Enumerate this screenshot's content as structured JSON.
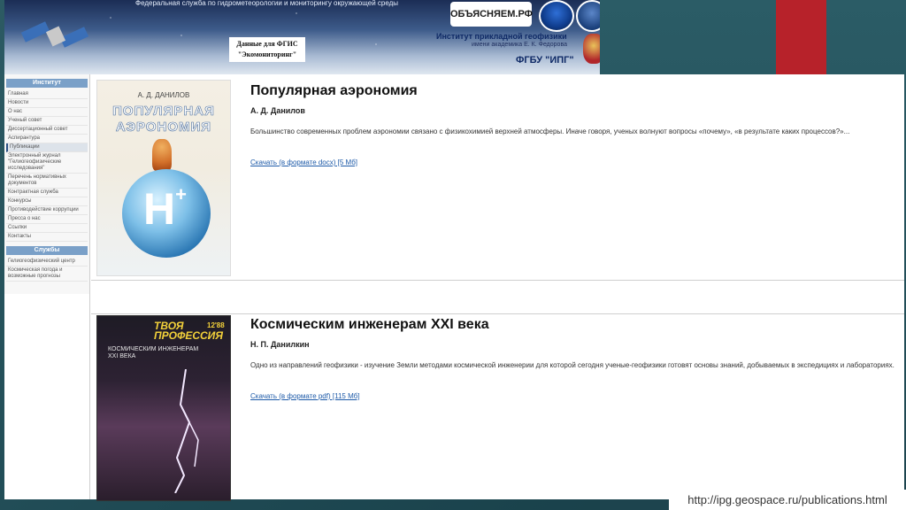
{
  "header": {
    "agency": "Федеральная служба по гидрометеорологии и мониторингу окружающей среды",
    "egis_line1": "Данные для ФГИС",
    "egis_line2": "\"Экомониторинг\"",
    "obyasnyaem": "ОБЪЯСНЯЕМ.РФ",
    "institute_title": "Институт прикладной геофизики",
    "institute_sub": "имени академика Е. К. Федорова",
    "fgbu": "ФГБУ \"ИПГ\""
  },
  "sidebar": {
    "institute_header": "Институт",
    "items": [
      {
        "label": "Главная"
      },
      {
        "label": "Новости"
      },
      {
        "label": "О нас"
      },
      {
        "label": "Ученый совет"
      },
      {
        "label": "Диссертационный совет"
      },
      {
        "label": "Аспирантура"
      },
      {
        "label": "Публикации"
      },
      {
        "label": "Электронный журнал \"Гелиогеофизические исследования\""
      },
      {
        "label": "Перечень нормативных документов"
      },
      {
        "label": "Контрактная служба"
      },
      {
        "label": "Конкурсы"
      },
      {
        "label": "Противодействие коррупции"
      },
      {
        "label": "Пресса о нас"
      },
      {
        "label": "Ссылки"
      },
      {
        "label": "Контакты"
      }
    ],
    "services_header": "Службы",
    "services": [
      {
        "label": "Гелиогеофизический центр"
      },
      {
        "label": "Космическая погода и возможные прогнозы"
      }
    ]
  },
  "publications": [
    {
      "cover_author": "А. Д. ДАНИЛОВ",
      "cover_title": "ПОПУЛЯРНАЯ АЭРОНОМИЯ",
      "title": "Популярная аэрономия",
      "author": "А. Д. Данилов",
      "description": "Большинство современных проблем аэрономии связано с физикохимией верхней атмосферы. Иначе говоря, ученых волнуют вопросы «почему», «в результате каких процессов?»...",
      "link": "Скачать (в формате docx) [5 Мб]"
    },
    {
      "cover_head": "ТВОЯ ПРОФЕССИЯ",
      "cover_num": "12'88",
      "cover_sub": "КОСМИЧЕСКИМ ИНЖЕНЕРАМ XXI ВЕКА",
      "title": "Космическим инженерам XXI века",
      "author": "Н. П. Данилкин",
      "description": "Одно из направлений геофизики - изучение Земли методами космической инженерии для которой сегодня ученые-геофизики готовят основы знаний, добываемых в экспедициях и лабораториях.",
      "link": "Скачать (в формате pdf) [115 Мб]"
    }
  ],
  "url": "http://ipg.geospace.ru/publications.html",
  "colors": {
    "accent": "#1d5aa8",
    "sidebar_head": "#7aa0c8",
    "red_bar": "#b7222a"
  }
}
